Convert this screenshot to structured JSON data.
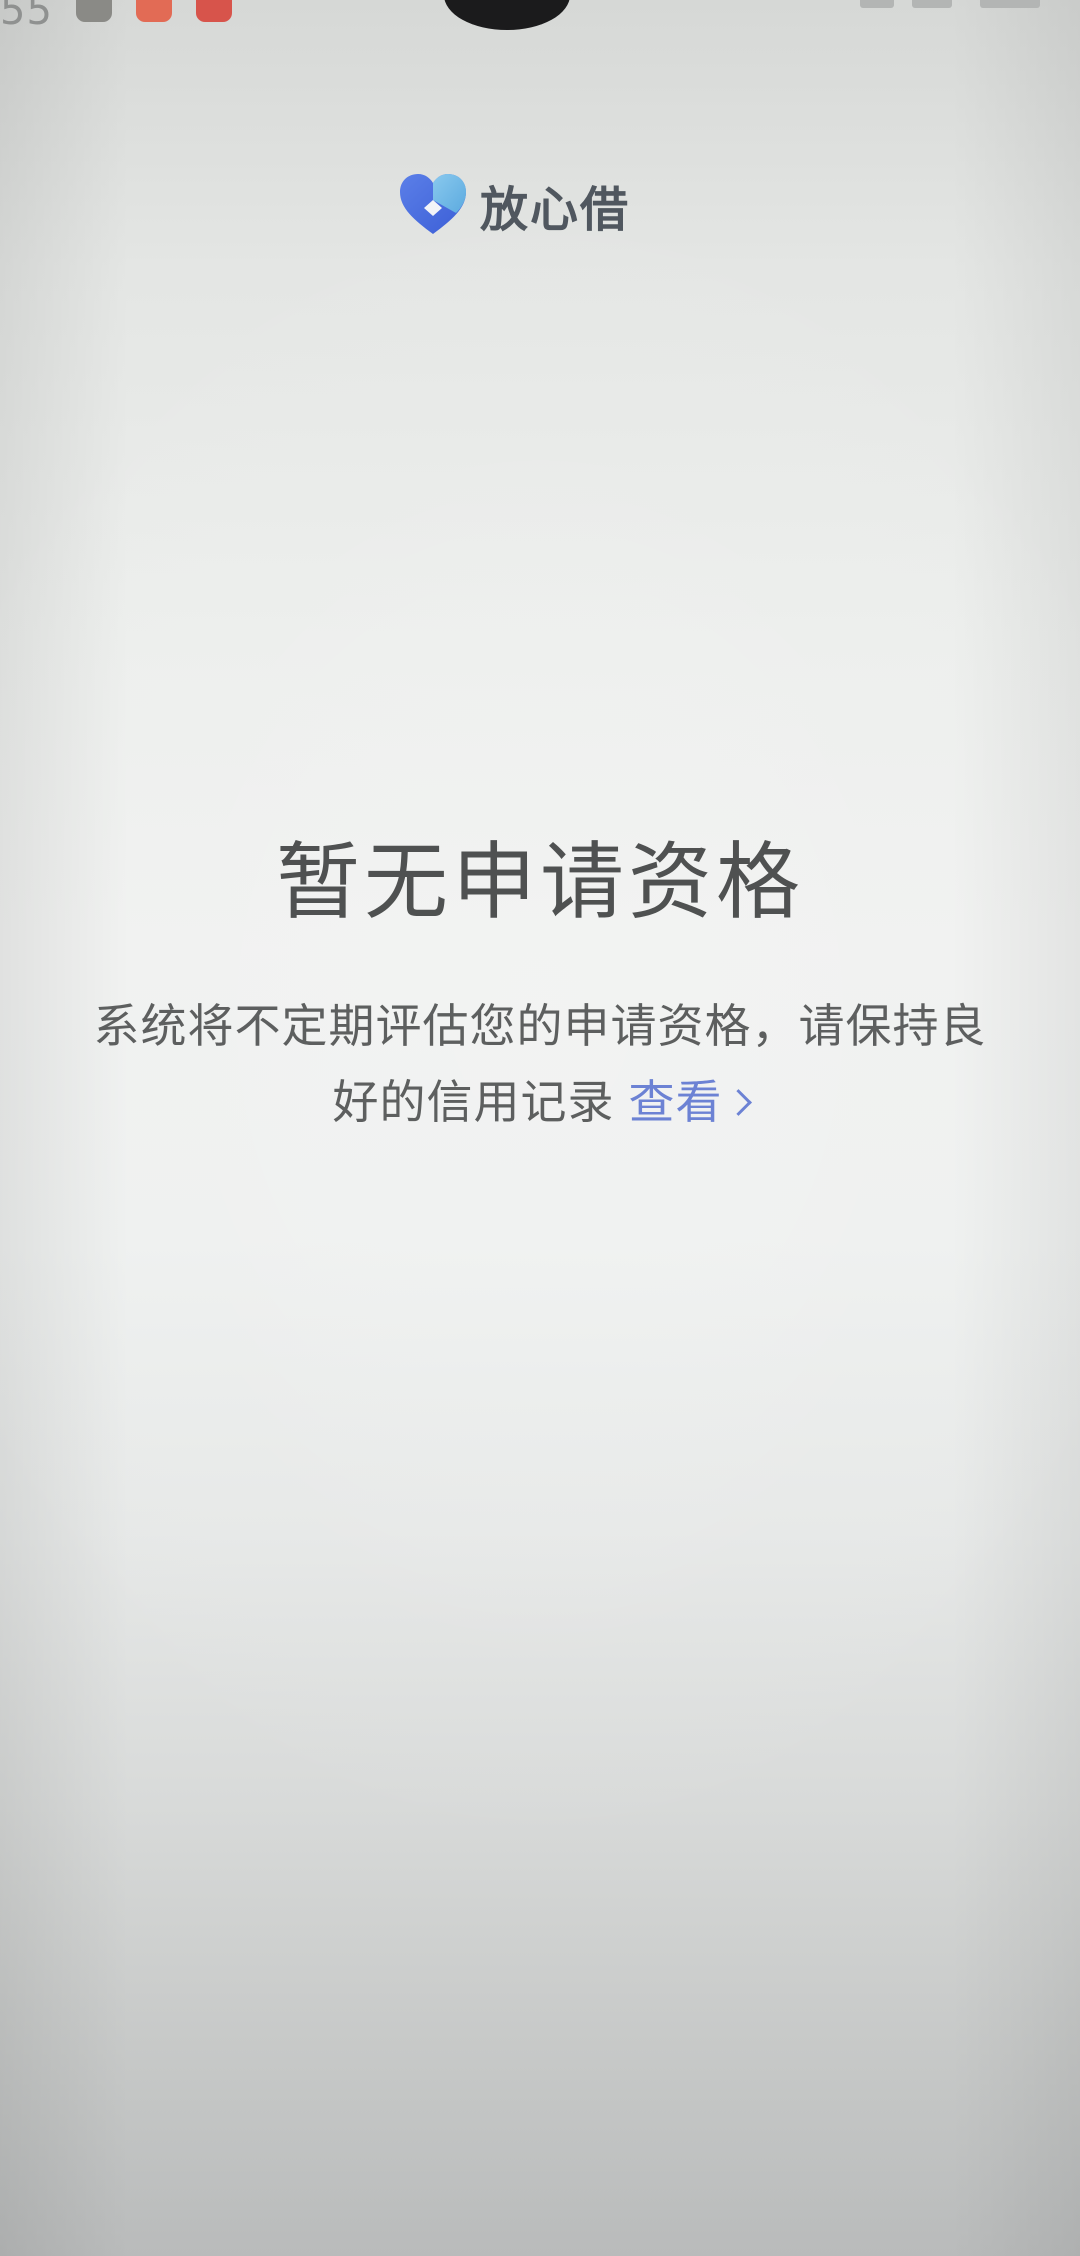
{
  "status_bar": {
    "time": "55"
  },
  "brand": {
    "name": "放心借",
    "icon": "heart-shield-logo-icon",
    "colors": {
      "primary": "#4a6fe3",
      "secondary": "#7fc6e8",
      "text": "#50575f"
    }
  },
  "empty_state": {
    "title": "暂无申请资格",
    "description_line1": "系统将不定期评估您的申请资格，请保持良",
    "description_line2": "好的信用记录",
    "link_label": "查看",
    "link_icon": "chevron-right-icon",
    "link_color": "#6c82d4"
  }
}
